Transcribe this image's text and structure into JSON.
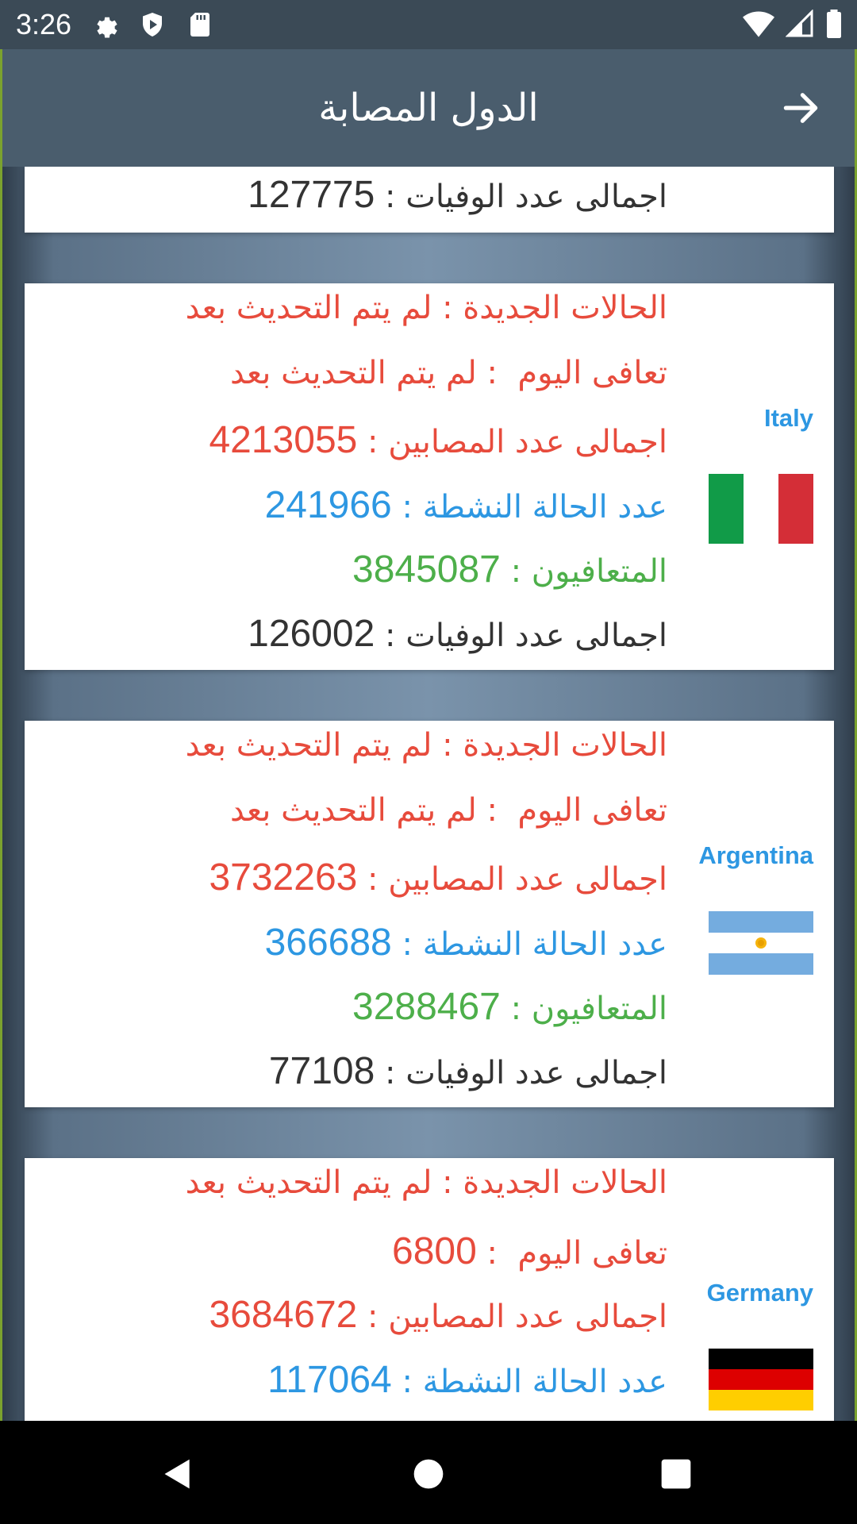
{
  "status_bar": {
    "time": "3:26",
    "icons": [
      "gear-icon",
      "shield-play-icon",
      "sd-card-icon",
      "wifi-icon",
      "signal-icon",
      "battery-icon"
    ]
  },
  "app_bar": {
    "title": "الدول المصابة",
    "back_icon": "arrow-right-icon"
  },
  "labels": {
    "new_cases": "الحالات الجديدة",
    "recovered_today": "تعافى اليوم",
    "total_cases": "اجمالى عدد المصابين",
    "active": "عدد الحالة النشطة",
    "recovered": "المتعافيون",
    "deaths": "اجمالى عدد الوفيات",
    "not_updated": "لم يتم التحديث بعد"
  },
  "partial_card": {
    "deaths": "127775"
  },
  "countries": [
    {
      "name": "Italy",
      "flag": "italy-flag",
      "new_cases": "لم يتم التحديث بعد",
      "recovered_today": "لم يتم التحديث بعد",
      "total_cases": "4213055",
      "active": "241966",
      "recovered": "3845087",
      "deaths": "126002"
    },
    {
      "name": "Argentina",
      "flag": "argentina-flag",
      "new_cases": "لم يتم التحديث بعد",
      "recovered_today": "لم يتم التحديث بعد",
      "total_cases": "3732263",
      "active": "366688",
      "recovered": "3288467",
      "deaths": "77108"
    },
    {
      "name": "Germany",
      "flag": "germany-flag",
      "new_cases": "لم يتم التحديث بعد",
      "recovered_today": "6800",
      "total_cases": "3684672",
      "active": "117064"
    }
  ],
  "colors": {
    "new_cases": "#e74b3c",
    "active": "#2d97e2",
    "recovered": "#4daf4a",
    "deaths": "#333333"
  }
}
